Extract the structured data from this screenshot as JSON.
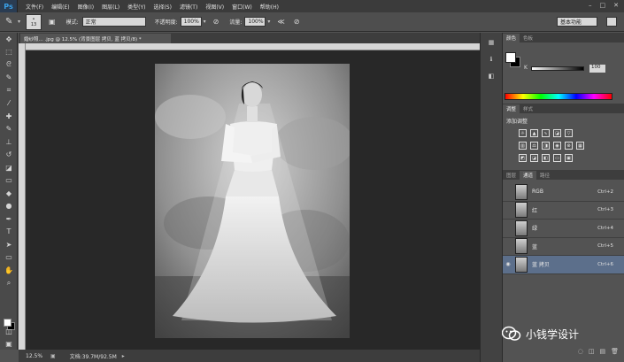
{
  "app": {
    "logo": "Ps"
  },
  "menu": [
    "文件(F)",
    "编辑(E)",
    "图像(I)",
    "图层(L)",
    "类型(Y)",
    "选择(S)",
    "滤镜(T)",
    "视图(V)",
    "窗口(W)",
    "帮助(H)"
  ],
  "window_controls": [
    "–",
    "□",
    "✕"
  ],
  "options": {
    "brush_size": "13",
    "mode_label": "模式:",
    "mode_value": "正常",
    "opacity_label": "不透明度:",
    "opacity_value": "100%",
    "flow_label": "流量:",
    "flow_value": "100%",
    "workspace": "基本功能"
  },
  "document": {
    "tab_title": "婚纱照... .jpg @ 12.5% (背景图层 拷贝, 蓝 拷贝/8) *",
    "zoom": "12.5%",
    "doc_info": "文档:39.7M/92.5M"
  },
  "panels": {
    "color_tabs": [
      "颜色",
      "色板"
    ],
    "color_value": "100",
    "adjust_tabs": [
      "调整",
      "样式"
    ],
    "adjust_title": "添加调整",
    "layer_tabs": [
      "图层",
      "通道",
      "路径"
    ],
    "channels": [
      {
        "name": "RGB",
        "shortcut": "Ctrl+2",
        "selected": false,
        "visible": false
      },
      {
        "name": "红",
        "shortcut": "Ctrl+3",
        "selected": false,
        "visible": false
      },
      {
        "name": "绿",
        "shortcut": "Ctrl+4",
        "selected": false,
        "visible": false
      },
      {
        "name": "蓝",
        "shortcut": "Ctrl+5",
        "selected": false,
        "visible": false
      },
      {
        "name": "蓝 拷贝",
        "shortcut": "Ctrl+6",
        "selected": true,
        "visible": true
      }
    ]
  },
  "watermark": "小钱学设计",
  "icons": {
    "toolbar": [
      "move-icon",
      "marquee-icon",
      "lasso-icon",
      "quick-select-icon",
      "crop-icon",
      "eyedropper-icon",
      "healing-icon",
      "brush-icon",
      "stamp-icon",
      "history-brush-icon",
      "eraser-icon",
      "gradient-icon",
      "blur-icon",
      "dodge-icon",
      "pen-icon",
      "type-icon",
      "path-select-icon",
      "shape-icon",
      "hand-icon",
      "zoom-icon"
    ]
  }
}
